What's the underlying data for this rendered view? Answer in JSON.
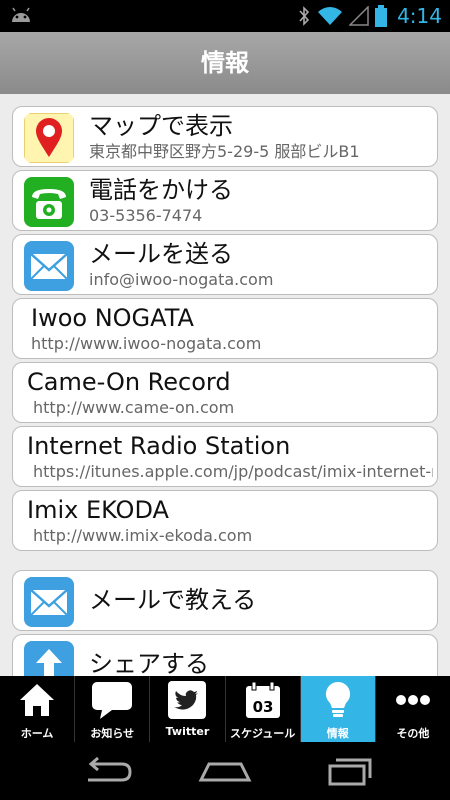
{
  "status": {
    "time": "4:14"
  },
  "header": {
    "title": "情報"
  },
  "items": [
    {
      "main": "マップで表示",
      "sub": "東京都中野区野方5-29-5 服部ビルB1",
      "icon": "map-pin-icon"
    },
    {
      "main": "電話をかける",
      "sub": "03-5356-7474",
      "icon": "phone-icon"
    },
    {
      "main": "メールを送る",
      "sub": "info@iwoo-nogata.com",
      "icon": "mail-icon"
    },
    {
      "main": "Iwoo NOGATA",
      "sub": "http://www.iwoo-nogata.com"
    },
    {
      "main": "Came-On Record",
      "sub": "http://www.came-on.com"
    },
    {
      "main": "Internet Radio Station",
      "sub": "https://itunes.apple.com/jp/podcast/imix-internet-r"
    },
    {
      "main": "Imix EKODA",
      "sub": "http://www.imix-ekoda.com"
    },
    {
      "main": "メールで教える",
      "icon": "mail-icon"
    },
    {
      "main": "シェアする",
      "icon": "share-icon"
    }
  ],
  "tabs": [
    {
      "label": "ホーム",
      "icon": "home-icon"
    },
    {
      "label": "お知らせ",
      "icon": "speech-bubble-icon"
    },
    {
      "label": "Twitter",
      "icon": "twitter-icon"
    },
    {
      "label": "スケジュール",
      "icon": "calendar-icon",
      "badge": "03"
    },
    {
      "label": "情報",
      "icon": "lightbulb-icon",
      "active": true
    },
    {
      "label": "その他",
      "icon": "more-icon"
    }
  ],
  "colors": {
    "accent": "#33b5e5",
    "header": "#999999",
    "background": "#ececec"
  }
}
